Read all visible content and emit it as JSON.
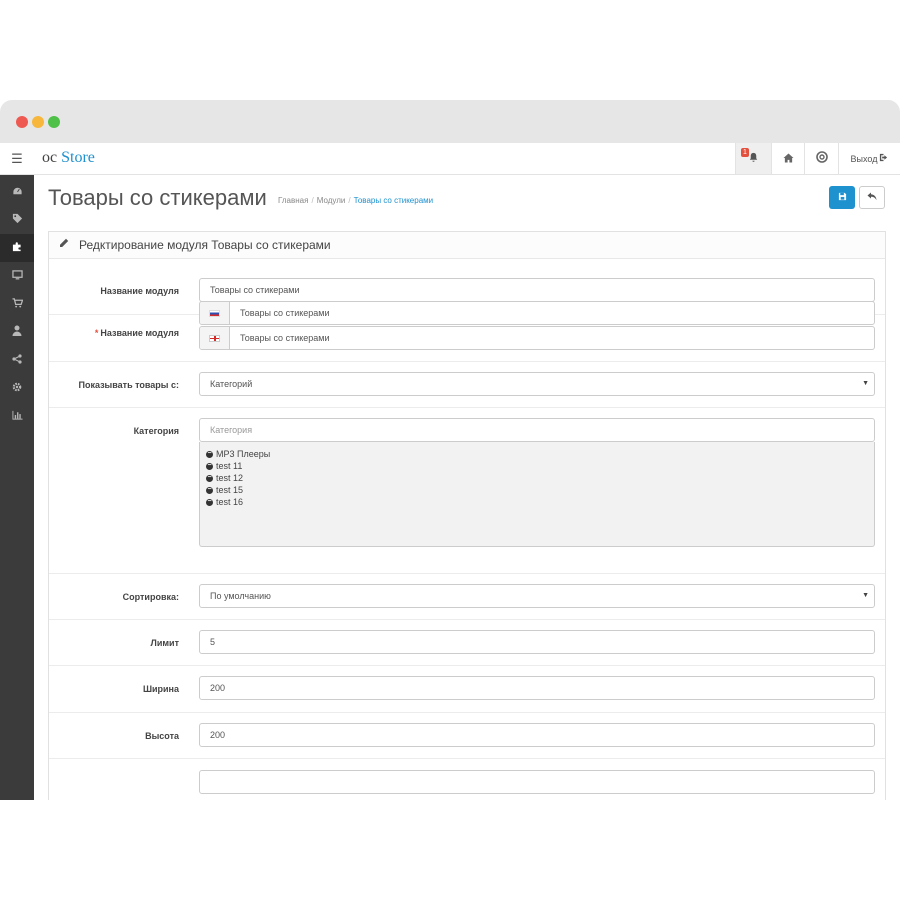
{
  "header": {
    "logo_oc": "oc",
    "logo_store": "Store",
    "notifications_count": "1",
    "logout_label": "Выход"
  },
  "page": {
    "title": "Товары со стикерами",
    "breadcrumb": [
      "Главная",
      "Модули",
      "Товары со стикерами"
    ]
  },
  "panel": {
    "heading": "Редктирование модуля Товары со стикерами"
  },
  "form": {
    "module_name": {
      "label": "Название модуля",
      "value": "Товары со стикерами"
    },
    "module_title": {
      "label": "Название модуля",
      "required": "*",
      "ru_value": "Товары со стикерами",
      "en_value": "Товары со стикерами"
    },
    "show_from": {
      "label": "Показывать товары с:",
      "value": "Категорий"
    },
    "category": {
      "label": "Категория",
      "placeholder": "Категория",
      "items": [
        "MP3 Плееры",
        "test 11",
        "test 12",
        "test 15",
        "test 16"
      ]
    },
    "sort": {
      "label": "Сортировка:",
      "value": "По умолчанию"
    },
    "limit": {
      "label": "Лимит",
      "value": "5"
    },
    "width": {
      "label": "Ширина",
      "value": "200"
    },
    "height": {
      "label": "Высота",
      "value": "200"
    }
  },
  "colors": {
    "accent": "#1e91cf",
    "sidebar": "#3b3b3b",
    "badge": "#e3503e"
  }
}
